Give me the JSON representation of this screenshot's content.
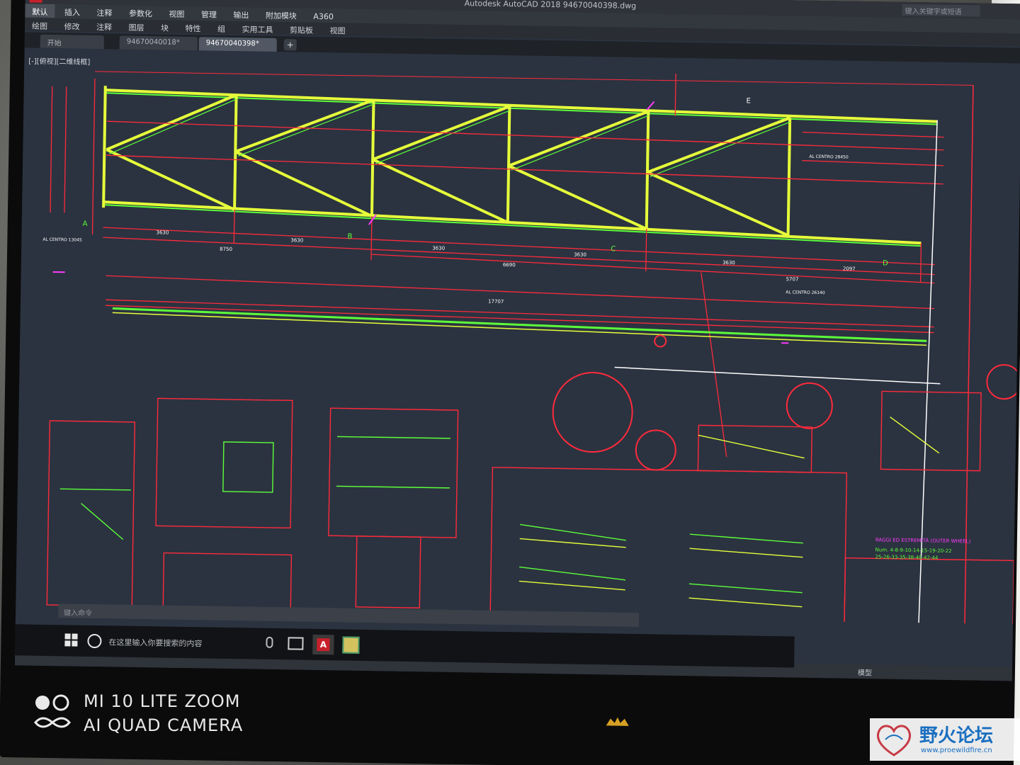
{
  "window": {
    "title": "Autodesk AutoCAD 2018   94670040398.dwg",
    "app_logo": "A",
    "search_placeholder": "键入关键字或短语"
  },
  "menu": [
    "默认",
    "插入",
    "注释",
    "参数化",
    "视图",
    "管理",
    "输出",
    "附加模块",
    "A360"
  ],
  "ribbon": [
    "绘图",
    "修改",
    "注释",
    "图层",
    "块",
    "特性",
    "组",
    "实用工具",
    "剪贴板",
    "视图"
  ],
  "doc_tabs": [
    "开始",
    "94670040018*",
    "94670040398*"
  ],
  "add_tab": "+",
  "viewport_label": "[-][俯视][二维线框]",
  "drawing": {
    "dims_bottom": [
      "3630",
      "3630",
      "3630",
      "3630",
      "3630",
      "2097"
    ],
    "dims_total": [
      "8750",
      "6690",
      "5707"
    ],
    "rod_length": "17707",
    "labels": [
      "A",
      "B",
      "C",
      "D",
      "E"
    ],
    "note1": "AL CENTRO 13045",
    "note2": "AL CENTRO 26140",
    "note3": "AL CENTRO 28450",
    "table_title": "RAGGI ED ESTREMITÀ (OUTER WHEEL)",
    "table_line1": "Num. 4-8-9-10-14-15-19-20-22",
    "table_line2": "25-26-33-35-38-40-42-44"
  },
  "command_line_placeholder": "键入命令",
  "status_mode": "模型",
  "taskbar": {
    "search_placeholder": "在这里输入你要搜索的内容"
  },
  "camera": {
    "line1": "MI 10 LITE ZOOM",
    "line2": "AI QUAD CAMERA"
  },
  "watermark": {
    "name": "野火论坛",
    "url": "www.proewildfire.cn"
  },
  "colors": {
    "cad_bg": "#2b3340",
    "red": "#ff2a3c",
    "green": "#5cff3a",
    "yellow": "#e6ff3a",
    "magenta": "#ff3aff",
    "accent_red": "#c8202b"
  }
}
